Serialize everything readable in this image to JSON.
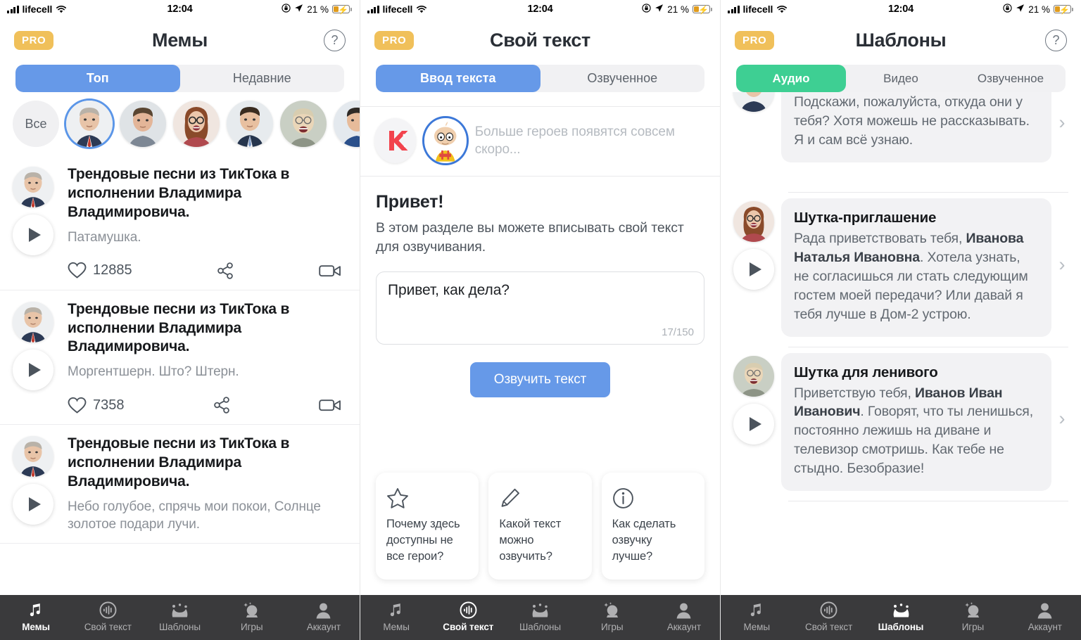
{
  "status_bar": {
    "carrier": "lifecell",
    "time": "12:04",
    "battery_percent": "21 %"
  },
  "colors": {
    "blue_accent": "#6699e8",
    "green_accent": "#3ecf93",
    "pro_badge": "#f0c05a",
    "tabbar_bg": "#3a3a3c",
    "bubble_bg": "#f2f2f4"
  },
  "panel1": {
    "pro_label": "PRO",
    "title": "Мемы",
    "help_label": "?",
    "tabs": [
      {
        "label": "Топ",
        "active": true
      },
      {
        "label": "Недавние",
        "active": false
      }
    ],
    "avatar_all_label": "Все",
    "avatars": [
      {
        "name": "putin",
        "selected": true
      },
      {
        "name": "medvedev",
        "selected": false
      },
      {
        "name": "sobchak",
        "selected": false
      },
      {
        "name": "businessman",
        "selected": false
      },
      {
        "name": "zhirinovsky",
        "selected": false
      },
      {
        "name": "partial-hero",
        "selected": false
      }
    ],
    "memes": [
      {
        "title": "Трендовые песни из ТикТока в исполнении Владимира Владимировича.",
        "subtitle": "Патамушка.",
        "likes": "12885"
      },
      {
        "title": "Трендовые песни из ТикТока в исполнении Владимира Владимировича.",
        "subtitle": "Моргентшерн. Што? Штерн.",
        "likes": "7358"
      },
      {
        "title": "Трендовые песни из ТикТока в исполнении Владимира Владимировича.",
        "subtitle": "Небо голубое, спрячь мои покои, Солнце золотое подари лучи.",
        "likes": ""
      }
    ]
  },
  "panel2": {
    "pro_label": "PRO",
    "title": "Свой текст",
    "tabs": [
      {
        "label": "Ввод текста",
        "active": true
      },
      {
        "label": "Озвученное",
        "active": false
      }
    ],
    "characters_hint": "Больше героев появятся совсем скоро...",
    "greeting": "Привет!",
    "greeting_sub": "В этом разделе вы можете вписывать свой текст для озвучивания.",
    "textarea_value": "Привет, как дела?",
    "char_count": "17/150",
    "speak_button": "Озвучить текст",
    "faq": [
      {
        "icon": "star-icon",
        "text": "Почему здесь доступны не все герои?"
      },
      {
        "icon": "pencil-icon",
        "text": "Какой текст можно озвучить?"
      },
      {
        "icon": "info-icon",
        "text": "Как сделать озвучку лучше?"
      }
    ]
  },
  "panel3": {
    "pro_label": "PRO",
    "title": "Шаблоны",
    "help_label": "?",
    "tabs": [
      {
        "label": "Аудио",
        "active": true
      },
      {
        "label": "Видео",
        "active": false
      },
      {
        "label": "Озвученное",
        "active": false
      }
    ],
    "templates": [
      {
        "title": "",
        "avatar": "putin",
        "text_plain": "несколько миллиардов долларов. Подскажи, пожалуйста, откуда они у тебя? Хотя можешь не рассказывать. Я и сам всё узнаю."
      },
      {
        "title": "Шутка-приглашение",
        "avatar": "sobchak",
        "text_before": "Рада приветствовать тебя, ",
        "text_bold": "Иванова Наталья Ивановна",
        "text_after": ". Хотела узнать, не согласишься ли стать следующим гостем моей передачи? Или давай я тебя лучше в Дом-2 устрою."
      },
      {
        "title": "Шутка для ленивого",
        "avatar": "zhirinovsky",
        "text_before": "Приветствую тебя, ",
        "text_bold": "Иванов Иван Иванович",
        "text_after": ". Говорят, что ты ленишься, постоянно лежишь на диване и телевизор смотришь. Как тебе не стыдно. Безобразие!"
      }
    ]
  },
  "tabbar": {
    "items": [
      {
        "label": "Мемы",
        "icon": "music-note-icon"
      },
      {
        "label": "Свой текст",
        "icon": "waveform-circle-icon"
      },
      {
        "label": "Шаблоны",
        "icon": "jester-hat-icon"
      },
      {
        "label": "Игры",
        "icon": "crystal-ball-icon"
      },
      {
        "label": "Аккаунт",
        "icon": "person-icon"
      }
    ],
    "active": [
      0,
      1,
      2
    ]
  }
}
